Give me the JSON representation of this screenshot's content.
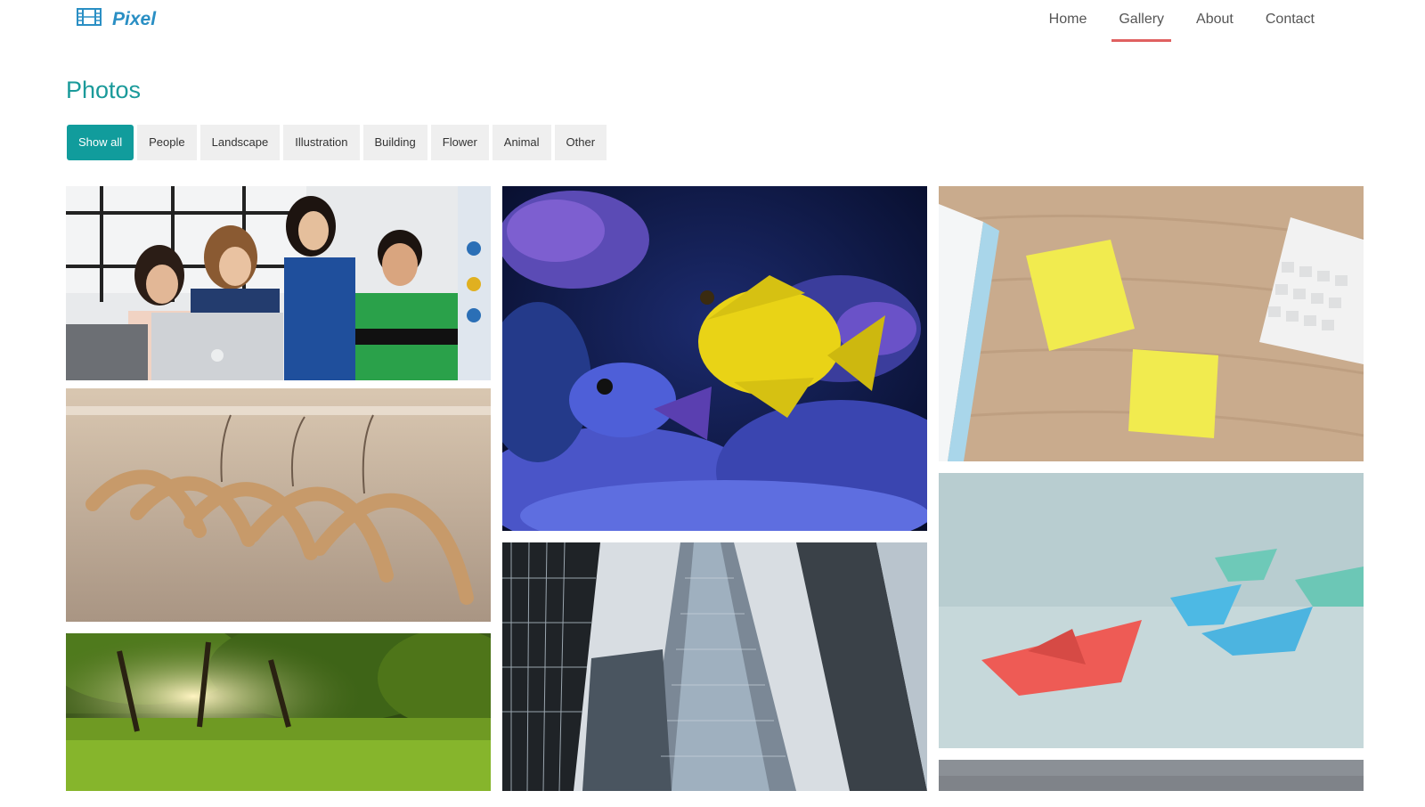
{
  "brand": {
    "name": "Pixel",
    "icon": "film-icon"
  },
  "nav": {
    "items": [
      {
        "label": "Home"
      },
      {
        "label": "Gallery",
        "active": true
      },
      {
        "label": "About"
      },
      {
        "label": "Contact"
      }
    ]
  },
  "page": {
    "title": "Photos"
  },
  "filters": [
    {
      "label": "Show all",
      "active": true
    },
    {
      "label": "People"
    },
    {
      "label": "Landscape"
    },
    {
      "label": "Illustration"
    },
    {
      "label": "Building"
    },
    {
      "label": "Flower"
    },
    {
      "label": "Animal"
    },
    {
      "label": "Other"
    }
  ],
  "colors": {
    "brand": "#2a8fc4",
    "title": "#1a9a9a",
    "filter_active": "#119c9c",
    "nav_underline": "#e06060"
  }
}
